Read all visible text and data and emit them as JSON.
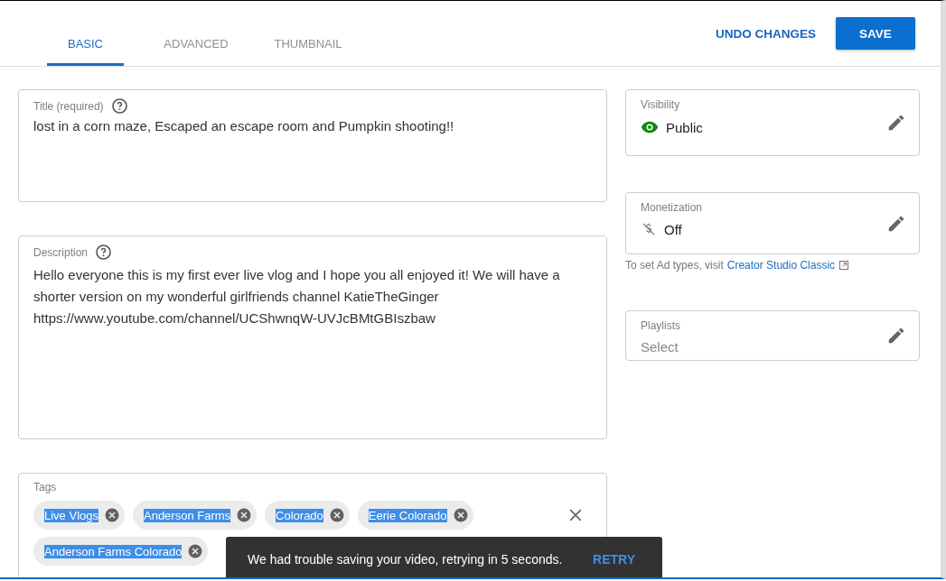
{
  "tabs": [
    {
      "label": "BASIC",
      "selected": true
    },
    {
      "label": "ADVANCED",
      "selected": false
    },
    {
      "label": "THUMBNAIL",
      "selected": false
    }
  ],
  "actions": {
    "undo": "UNDO CHANGES",
    "save": "SAVE"
  },
  "title_field": {
    "label": "Title (required)",
    "value": "lost in a corn maze, Escaped an escape room and Pumpkin shooting!!"
  },
  "description_field": {
    "label": "Description",
    "lines": [
      "Hello everyone this is my first ever live vlog and I hope you all enjoyed it! We will have a",
      "shorter version on my wonderful girlfriends channel KatieTheGinger",
      "https://www.youtube.com/channel/UCShwnqW-UVJcBMtGBIszbaw"
    ]
  },
  "tags_field": {
    "label": "Tags",
    "tags": [
      {
        "text": "Live Vlogs",
        "selected": true
      },
      {
        "text": "Anderson Farms",
        "selected": true
      },
      {
        "text": "Colorado",
        "selected": true
      },
      {
        "text": "Eerie Colorado",
        "selected": true
      },
      {
        "text": "Anderson Farms Colorado",
        "selected": true
      }
    ]
  },
  "side_cards": [
    {
      "kind": "visibility",
      "label": "Visibility",
      "value": "Public"
    },
    {
      "kind": "monetization",
      "label": "Monetization",
      "value": "Off",
      "note": "To set Ad types, visit",
      "link": "Creator Studio Classic"
    },
    {
      "kind": "playlists",
      "label": "Playlists",
      "placeholder": "Select"
    }
  ],
  "snackbar": {
    "message": "We had trouble saving your video, retrying in 5 seconds.",
    "action": "RETRY"
  }
}
